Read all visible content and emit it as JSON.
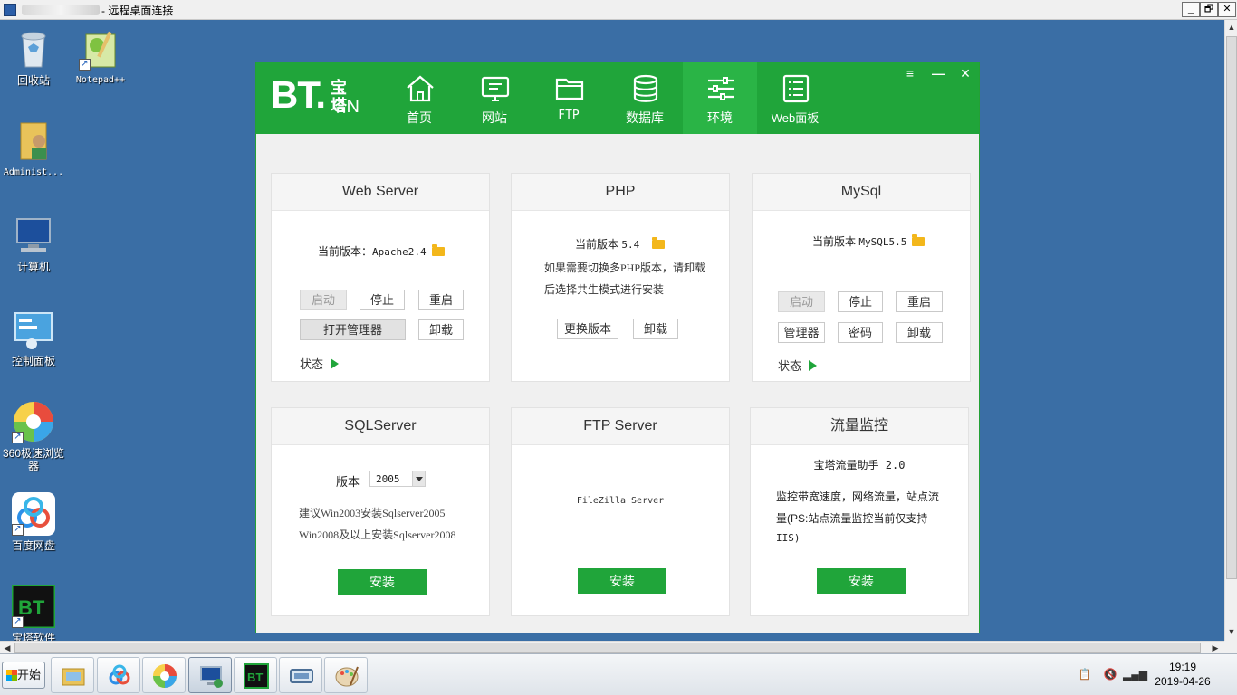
{
  "rdp": {
    "title": "- 远程桌面连接",
    "btn_min": "_",
    "btn_restore": "🗗",
    "btn_close": "✕"
  },
  "desktop": {
    "icons": [
      {
        "label": "回收站"
      },
      {
        "label": "Notepad++"
      },
      {
        "label": "Administ..."
      },
      {
        "label": "计算机"
      },
      {
        "label": "控制面板"
      },
      {
        "label": "360极速浏览器"
      },
      {
        "label": "百度网盘"
      },
      {
        "label": "宝塔软件"
      }
    ]
  },
  "bt": {
    "logo_bt": "BT.",
    "logo_baota": "宝塔",
    "logo_cn": "CN",
    "nav": [
      {
        "label": "首页",
        "icon": "home-icon"
      },
      {
        "label": "网站",
        "icon": "monitor-icon"
      },
      {
        "label": "FTP",
        "icon": "folder-icon"
      },
      {
        "label": "数据库",
        "icon": "database-icon"
      },
      {
        "label": "环境",
        "icon": "sliders-icon",
        "active": true
      },
      {
        "label": "Web面板",
        "icon": "list-icon"
      }
    ],
    "controls": {
      "menu": "≡",
      "min": "—",
      "close": "✕"
    },
    "web_server": {
      "title": "Web Server",
      "version_label": "当前版本：",
      "version_value": "Apache2.4",
      "start": "启动",
      "stop": "停止",
      "restart": "重启",
      "open_manager": "打开管理器",
      "uninstall": "卸载",
      "status": "状态"
    },
    "php": {
      "title": "PHP",
      "version_label": "当前版本",
      "version_value": "5.4",
      "note_line1": "如果需要切换多PHP版本，请卸载",
      "note_line2": "后选择共生模式进行安装",
      "change": "更换版本",
      "uninstall": "卸载"
    },
    "mysql": {
      "title": "MySql",
      "version_label": "当前版本",
      "version_value": "MySQL5.5",
      "start": "启动",
      "stop": "停止",
      "restart": "重启",
      "manager": "管理器",
      "password": "密码",
      "uninstall": "卸载",
      "status": "状态"
    },
    "sqlserver": {
      "title": "SQLServer",
      "version_label": "版本",
      "version_value": "2005",
      "note_line1": "建议Win2003安装Sqlserver2005",
      "note_line2": "Win2008及以上安装Sqlserver2008",
      "install": "安装"
    },
    "ftp_server": {
      "title": "FTP Server",
      "product": "FileZilla Server",
      "install": "安装"
    },
    "traffic": {
      "title": "流量监控",
      "product": "宝塔流量助手 2.0",
      "note_line1": "监控带宽速度，网络流量，站点流",
      "note_line2": "量(PS:站点流量监控当前仅支持",
      "note_line3": "IIS)",
      "install": "安装"
    }
  },
  "taskbar": {
    "start": "开始",
    "time": "19:19",
    "date": "2019-04-26"
  }
}
